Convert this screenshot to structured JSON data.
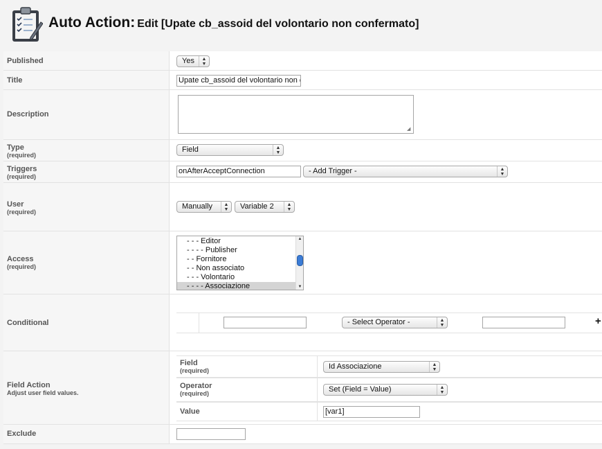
{
  "header": {
    "title_main": "Auto Action:",
    "title_sub": "Edit [Upate cb_assoid del volontario non confermato]",
    "icon": "clipboard-checklist-icon"
  },
  "form": {
    "required_note": "(required)",
    "published": {
      "label": "Published",
      "value": "Yes"
    },
    "title": {
      "label": "Title",
      "value": "Upate cb_assoid del volontario non confermato"
    },
    "description": {
      "label": "Description",
      "value": ""
    },
    "type": {
      "label": "Type",
      "value": "Field"
    },
    "triggers": {
      "label": "Triggers",
      "value": "onAfterAcceptConnection",
      "add_trigger": "- Add Trigger -"
    },
    "user": {
      "label": "User",
      "mode": "Manually",
      "variable": "Variable 2"
    },
    "access": {
      "label": "Access",
      "options": [
        "- - - Editor",
        "- - - - Publisher",
        "- - Fornitore",
        "- - Non associato",
        "- - - Volontario",
        "- - - - Associazione"
      ],
      "selected_index": 5
    },
    "conditional": {
      "label": "Conditional",
      "field_value": "",
      "operator": "- Select Operator -",
      "value": "",
      "add_symbol": "+"
    },
    "field_action": {
      "label": "Field Action",
      "description": "Adjust user field values.",
      "field": {
        "label": "Field",
        "value": "Id Associazione"
      },
      "operator": {
        "label": "Operator",
        "value": "Set (Field = Value)"
      },
      "value": {
        "label": "Value",
        "value": "[var1]"
      }
    },
    "exclude": {
      "label": "Exclude",
      "value": ""
    }
  }
}
